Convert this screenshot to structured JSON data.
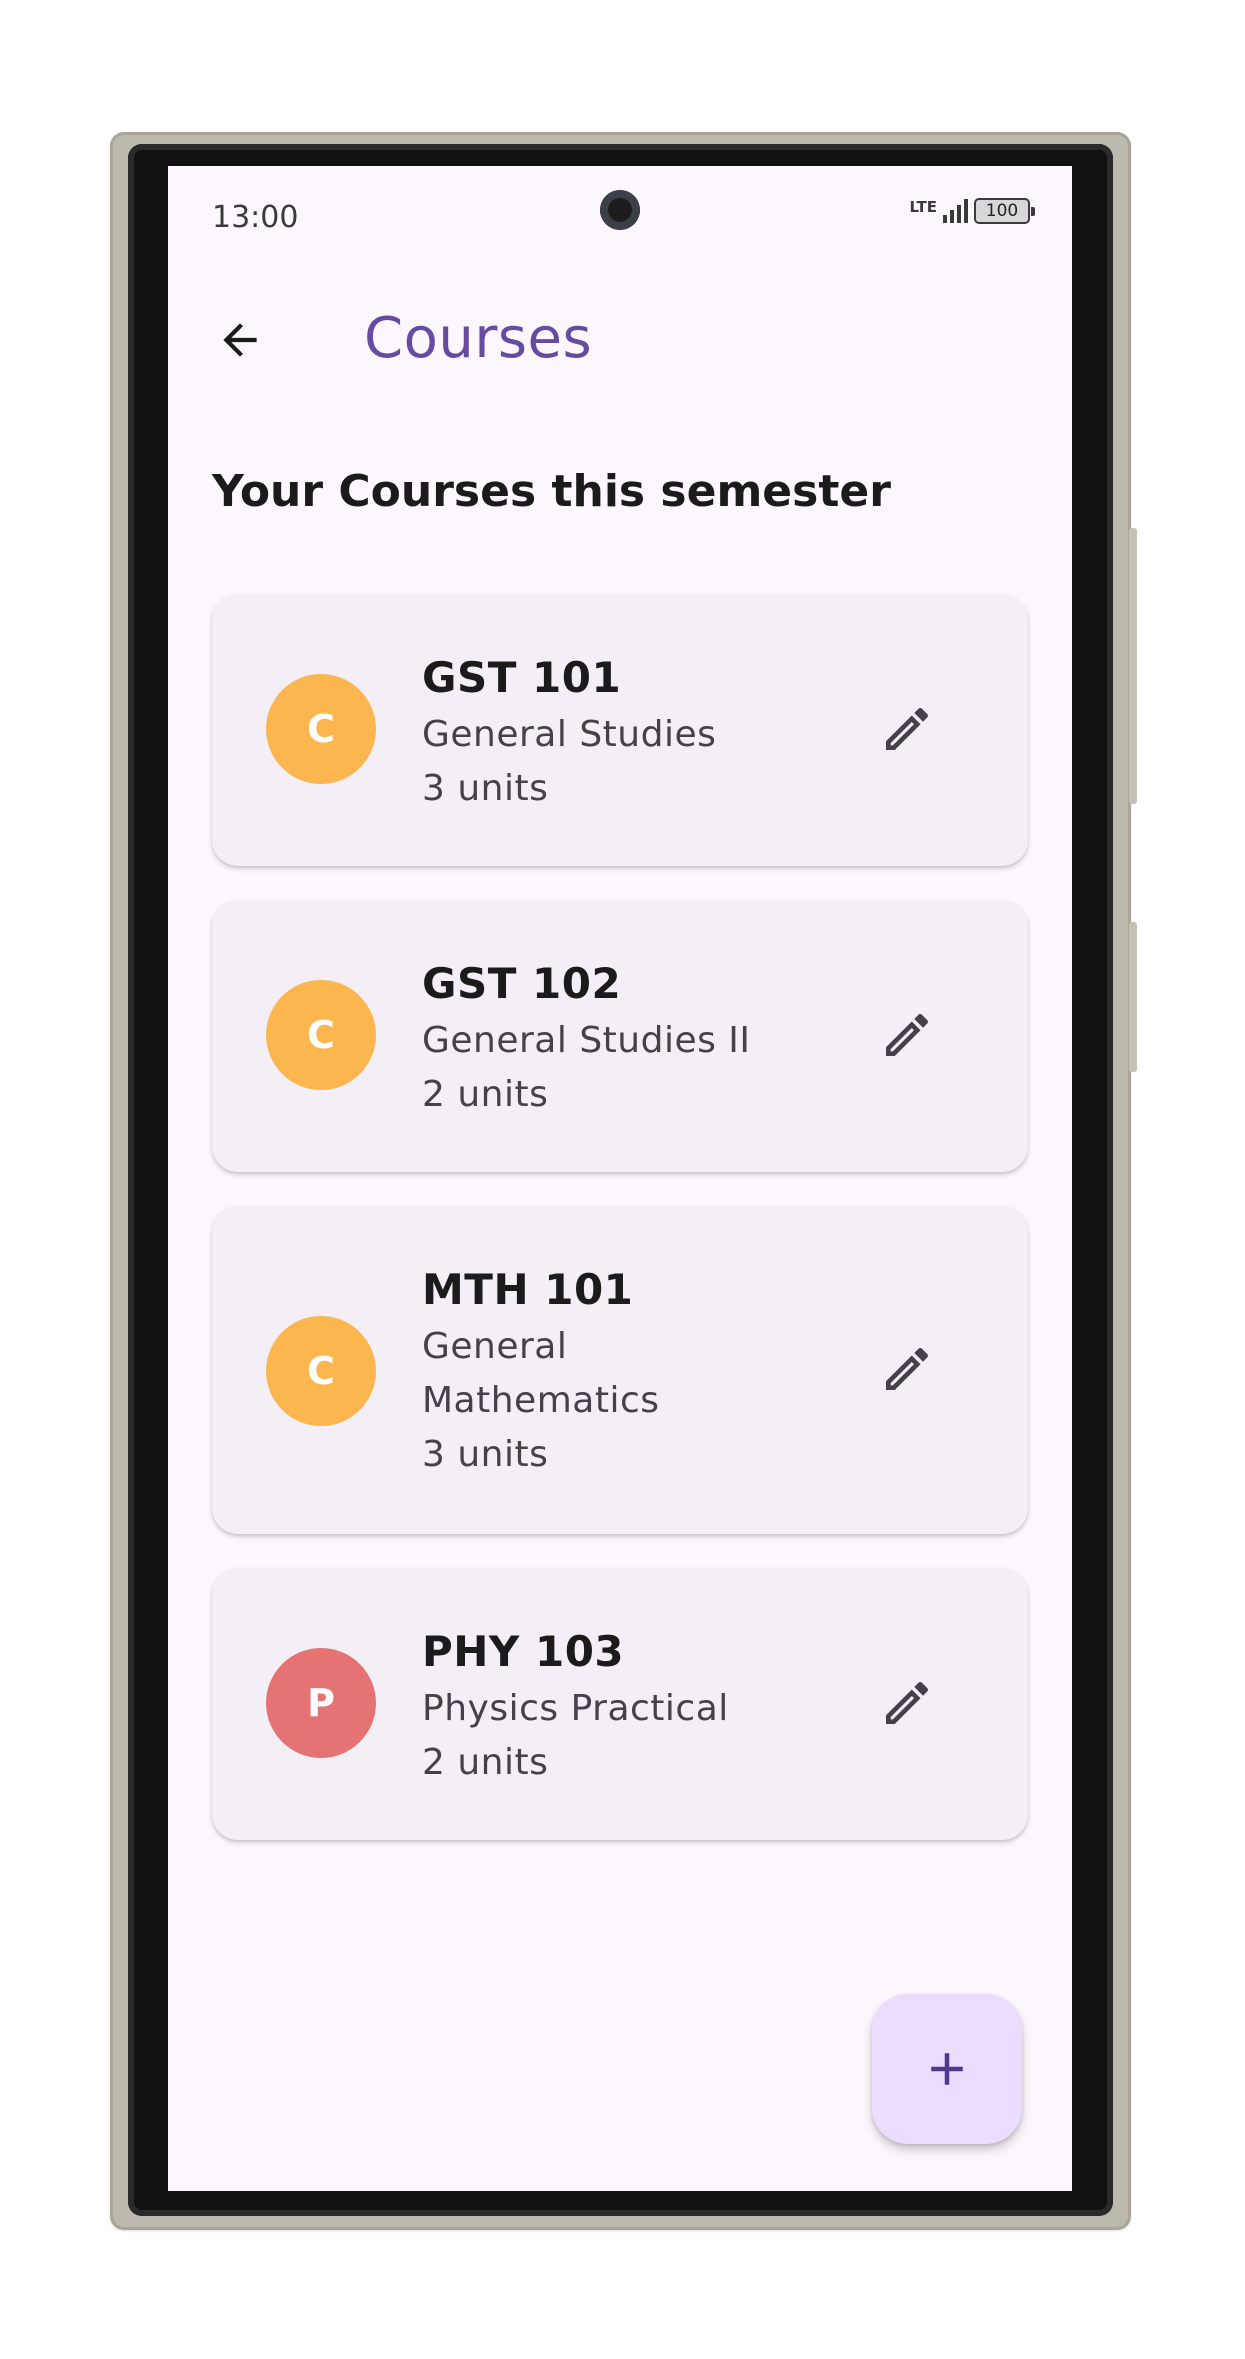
{
  "status_bar": {
    "time": "13:00",
    "network": "LTE",
    "battery": "100"
  },
  "app_bar": {
    "back_icon": "arrow-left-icon",
    "title": "Courses"
  },
  "main": {
    "heading": "Your Courses this semester",
    "courses": [
      {
        "initial": "C",
        "code": "GST 101",
        "name": "General Studies",
        "units": "3 units",
        "avatar_color": "#fbb650",
        "action_icon": "pencil-icon"
      },
      {
        "initial": "C",
        "code": "GST 102",
        "name": "General Studies II",
        "units": "2 units",
        "avatar_color": "#fbb650",
        "action_icon": "pencil-icon"
      },
      {
        "initial": "C",
        "code": "MTH 101",
        "name": "General Mathematics",
        "units": "3 units",
        "avatar_color": "#fbb650",
        "action_icon": "pencil-icon"
      },
      {
        "initial": "P",
        "code": "PHY 103",
        "name": "Physics Practical",
        "units": "2 units",
        "avatar_color": "#e57373",
        "action_icon": "pencil-icon"
      }
    ]
  },
  "fab": {
    "icon": "plus-icon"
  },
  "colors": {
    "title": "#654ca1",
    "background": "#fcf7fc",
    "card": "#f4eff6",
    "fab": "#eaddff"
  }
}
